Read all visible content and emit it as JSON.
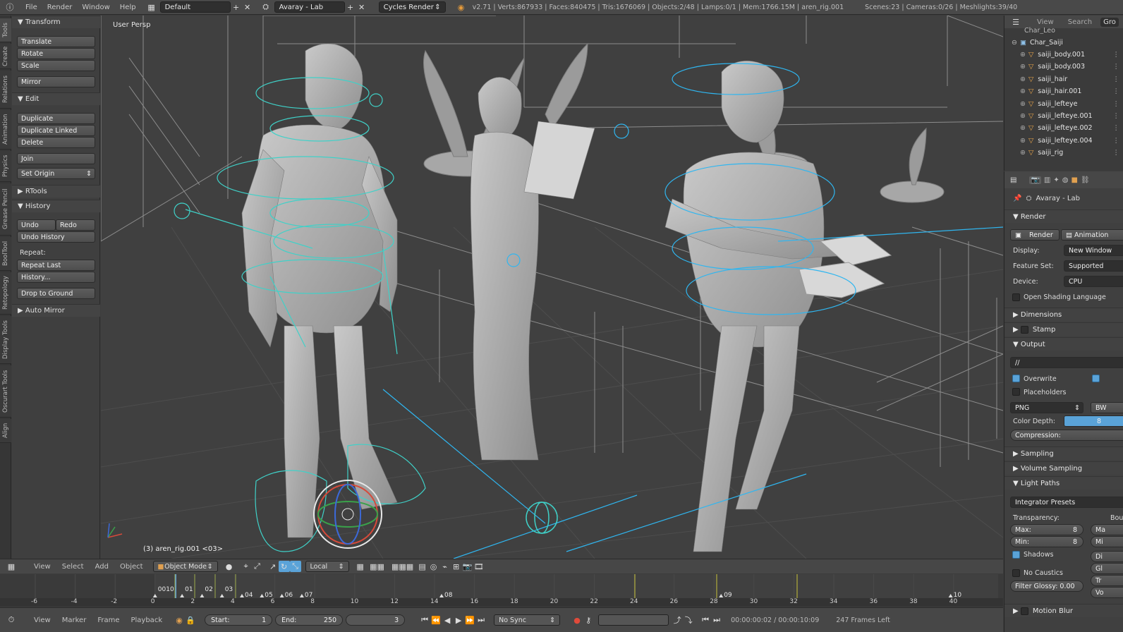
{
  "topbar": {
    "menus": [
      "File",
      "Render",
      "Window",
      "Help"
    ],
    "layout": "Default",
    "scene": "Avaray - Lab",
    "engine": "Cycles Render",
    "stats": "v2.71 | Verts:867933 | Faces:840475 | Tris:1676069 | Objects:2/48 | Lamps:0/1 | Mem:1766.15M | aren_rig.001",
    "stats_right": "Scenes:23 | Cameras:0/26 | Meshlights:39/40"
  },
  "tabs": [
    "Tools",
    "Create",
    "Relations",
    "Animation",
    "Physics",
    "Grease Pencil",
    "BoolTool",
    "Retopology",
    "Display Tools",
    "Oscurart Tools",
    "Align"
  ],
  "toolshelf": {
    "transform_header": "Transform",
    "translate": "Translate",
    "rotate": "Rotate",
    "scale": "Scale",
    "mirror": "Mirror",
    "edit_header": "Edit",
    "duplicate": "Duplicate",
    "duplicate_linked": "Duplicate Linked",
    "delete": "Delete",
    "join": "Join",
    "set_origin": "Set Origin",
    "rtools_header": "RTools",
    "history_header": "History",
    "undo": "Undo",
    "redo": "Redo",
    "undo_history": "Undo History",
    "repeat_label": "Repeat:",
    "repeat_last": "Repeat Last",
    "history_btn": "History...",
    "drop_to_ground": "Drop to Ground",
    "auto_mirror_header": "Auto Mirror"
  },
  "viewport": {
    "label": "User Persp",
    "object_info": "(3) aren_rig.001 <03>"
  },
  "outliner": {
    "tabs": [
      "View",
      "Search",
      "Gro"
    ],
    "partial_top": "Char_Leo",
    "group": "Char_Saiji",
    "items": [
      "saiji_body.001",
      "saiji_body.003",
      "saiji_hair",
      "saiji_hair.001",
      "saiji_lefteye",
      "saiji_lefteye.001",
      "saiji_lefteye.002",
      "saiji_lefteye.004",
      "saiji_rig"
    ]
  },
  "properties": {
    "scene_name": "Avaray - Lab",
    "render_header": "Render",
    "render_btn": "Render",
    "animation_btn": "Animation",
    "display_label": "Display:",
    "display_value": "New Window",
    "feature_label": "Feature Set:",
    "feature_value": "Supported",
    "device_label": "Device:",
    "device_value": "CPU",
    "osl": "Open Shading Language",
    "dimensions": "Dimensions",
    "stamp": "Stamp",
    "output": "Output",
    "output_path": "//",
    "overwrite": "Overwrite",
    "placeholders": "Placeholders",
    "format": "PNG",
    "bw": "BW",
    "color_depth_label": "Color Depth:",
    "color_depth": "8",
    "compression": "Compression:",
    "sampling": "Sampling",
    "volume_sampling": "Volume Sampling",
    "light_paths": "Light Paths",
    "integrator_presets": "Integrator Presets",
    "transparency": "Transparency:",
    "bounces": "Bou",
    "max_label": "Max:",
    "max_value": "8",
    "min_label": "Min:",
    "min_value": "8",
    "shadows": "Shadows",
    "no_caustics": "No Caustics",
    "filter_glossy": "Filter Glossy: 0.00",
    "motion_blur": "Motion Blur",
    "right_clipped": [
      "Ma",
      "Mi",
      "Di",
      "Gl",
      "Tr",
      "Vo"
    ]
  },
  "view_header": {
    "menus": [
      "View",
      "Select",
      "Add",
      "Object"
    ],
    "mode": "Object Mode",
    "orientation": "Local"
  },
  "timeline": {
    "ruler": [
      "-6",
      "-4",
      "-2",
      "0",
      "2",
      "4",
      "6",
      "8",
      "10",
      "12",
      "14",
      "16",
      "18",
      "20",
      "22",
      "24",
      "26",
      "28",
      "30",
      "32",
      "34",
      "36",
      "38",
      "40"
    ],
    "markers": [
      "0010",
      "01",
      "02",
      "03",
      "04",
      "05",
      "06",
      "07",
      "08",
      "09",
      "10"
    ]
  },
  "tl_header": {
    "menus": [
      "View",
      "Marker",
      "Frame",
      "Playback"
    ],
    "start_label": "Start:",
    "start": "1",
    "end_label": "End:",
    "end": "250",
    "current": "3",
    "sync": "No Sync",
    "timecode": "00:00:00:02 / 00:00:10:09",
    "frames_left": "247 Frames Left"
  },
  "colors": {
    "accent": "#5aa3d8",
    "rig": "#3fd1c8",
    "rig_blue": "#2fb6f0",
    "wire": "#9a9a9a"
  }
}
